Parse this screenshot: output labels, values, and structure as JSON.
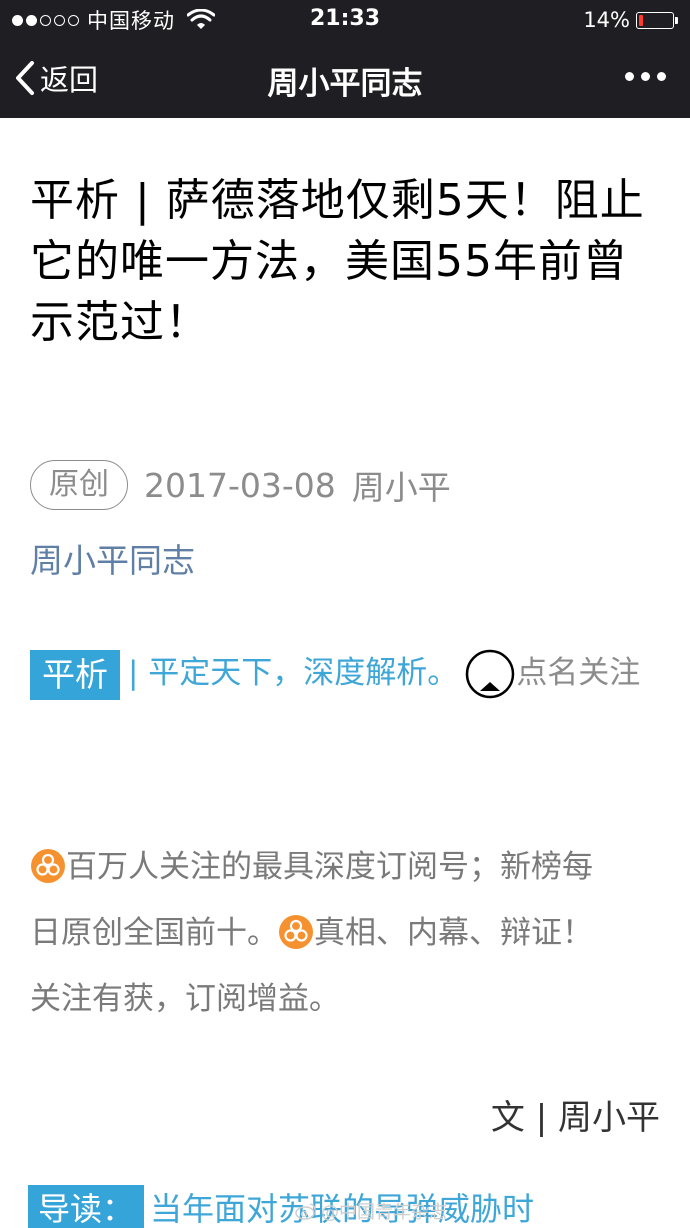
{
  "status_bar": {
    "carrier": "中国移动",
    "time": "21:33",
    "battery_percent_label": "14%",
    "battery_level": 0.14,
    "signal_bars_filled": 2,
    "signal_bars_total": 5
  },
  "nav": {
    "back_label": "返回",
    "title": "周小平同志"
  },
  "article": {
    "title": "平析 | 萨德落地仅剩5天！阻止它的唯一方法，美国55年前曾示范过！",
    "badge": "原创",
    "date": "2017-03-08",
    "author": "周小平",
    "account": "周小平同志",
    "intro_tag": "平析",
    "intro_blue": "| 平定天下，深度解析。",
    "intro_gray": "点名关注",
    "para_line_1a": "百万人关注的最具深度订阅号；新榜每",
    "para_line_2a": "日原创全国前十。",
    "para_line_2b": "真相、内幕、辩证！",
    "para_line_3": "关注有获，订阅增益。",
    "byline": "文 | 周小平",
    "next_tag": "导读：",
    "next_link": "当年面对苏联的导弹威胁时"
  },
  "watermark": "@中国青年杂志",
  "colors": {
    "nav_bg": "#1f1e23",
    "link_blue": "#607fa6",
    "tag_blue": "#35a4d8",
    "hazard_orange": "#f5922f",
    "battery_red": "#ff3b30"
  },
  "icons": [
    "wifi-icon",
    "battery-icon",
    "back-chevron-icon",
    "more-icon",
    "ring-icon",
    "biohazard-icon",
    "weibo-logo-icon"
  ]
}
